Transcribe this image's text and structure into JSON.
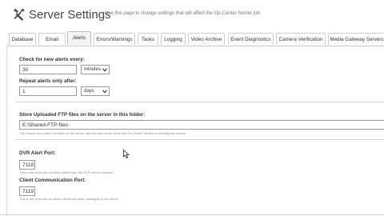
{
  "header": {
    "icon": "tools-icon",
    "title": "Server Settings",
    "subtitle": "Use this page to change settings that will affect the Op-Center Server job"
  },
  "tabs": [
    {
      "label": "Database",
      "active": false
    },
    {
      "label": "Email",
      "active": false
    },
    {
      "label": "Alerts",
      "active": true
    },
    {
      "label": "Errors/Warnings",
      "active": false
    },
    {
      "label": "Tasks",
      "active": false
    },
    {
      "label": "Logging",
      "active": false
    },
    {
      "label": "Video Archive",
      "active": false
    },
    {
      "label": "Event Diagnostics",
      "active": false
    },
    {
      "label": "Camera Verification",
      "active": false
    },
    {
      "label": "Media Gateway Servers",
      "active": false
    }
  ],
  "alerts": {
    "check_label": "Check for new alerts every:",
    "check_value": "30",
    "check_unit": "minutes",
    "repeat_label": "Repeat alerts only after:",
    "repeat_value": "1",
    "repeat_unit": "days",
    "ftp_label": "Store Uploaded FTP files on the server in this folder:",
    "ftp_value": "E:\\Shared-FTP-files",
    "ftp_hint": "This should be a path to a folder on the server that the user under which the Op-Center Service is running has access",
    "dvr_label": "DVR Alert Port:",
    "dvr_value": "7118",
    "dvr_hint": "This is the local port on which alerts from the DVR will be received",
    "client_label": "Client Communication Port:",
    "client_value": "7119",
    "client_hint": "This is the local port on which clients will send messages to the server"
  }
}
